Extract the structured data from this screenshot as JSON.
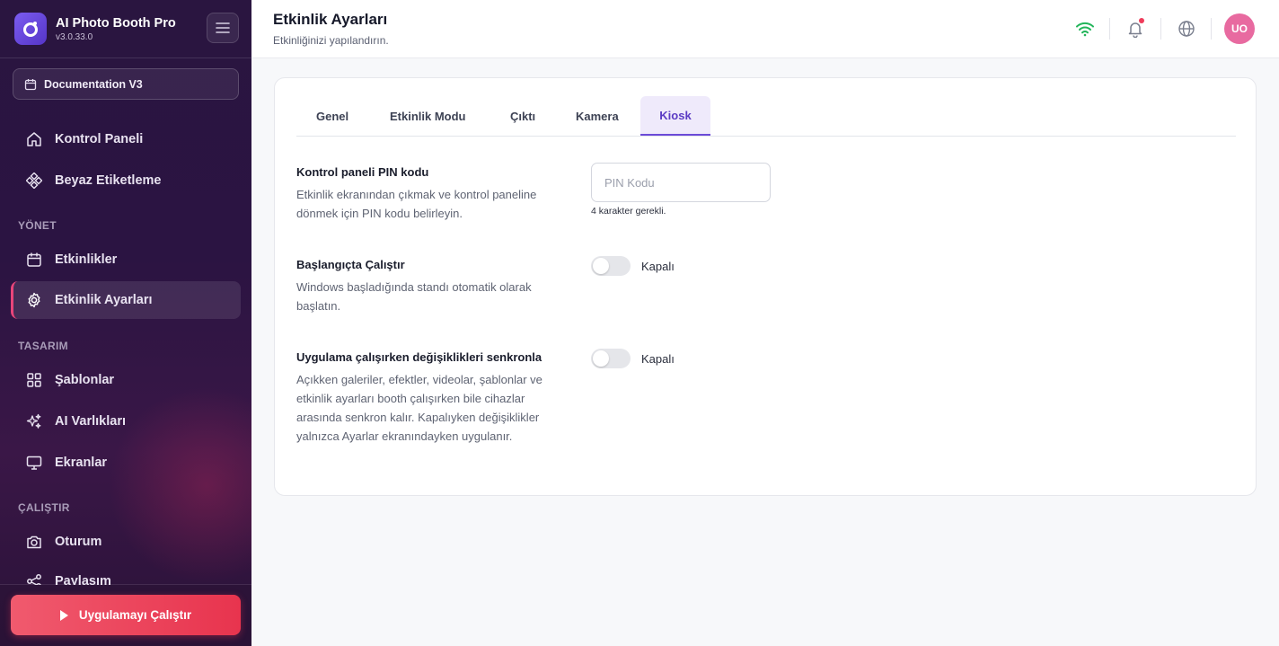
{
  "app": {
    "name": "AI Photo Booth Pro",
    "version": "v3.0.33.0"
  },
  "workspace": {
    "label": "Documentation V3"
  },
  "nav": {
    "top": [
      {
        "label": "Kontrol Paneli",
        "icon": "home-icon"
      },
      {
        "label": "Beyaz Etiketleme",
        "icon": "diamond-icon"
      }
    ],
    "sections": [
      {
        "title": "YÖNET",
        "items": [
          {
            "label": "Etkinlikler",
            "icon": "calendar-icon"
          },
          {
            "label": "Etkinlik Ayarları",
            "icon": "settings-icon",
            "active": true
          }
        ]
      },
      {
        "title": "TASARIM",
        "items": [
          {
            "label": "Şablonlar",
            "icon": "grid-icon"
          },
          {
            "label": "AI Varlıkları",
            "icon": "sparkles-icon"
          },
          {
            "label": "Ekranlar",
            "icon": "monitor-icon"
          }
        ]
      },
      {
        "title": "ÇALIŞTIR",
        "items": [
          {
            "label": "Oturum",
            "icon": "camera-icon"
          },
          {
            "label": "Paylaşım",
            "icon": "share-icon"
          }
        ]
      }
    ],
    "run_button": "Uygulamayı Çalıştır"
  },
  "header": {
    "title": "Etkinlik Ayarları",
    "subtitle": "Etkinliğinizi yapılandırın.",
    "avatar_initials": "UO",
    "wifi_color": "#22b55a",
    "notification_dot_color": "#ef3b5a"
  },
  "tabs": [
    {
      "label": "Genel"
    },
    {
      "label": "Etkinlik Modu"
    },
    {
      "label": "Çıktı"
    },
    {
      "label": "Kamera"
    },
    {
      "label": "Kiosk",
      "active": true
    }
  ],
  "settings": {
    "pin": {
      "title": "Kontrol paneli PIN kodu",
      "description": "Etkinlik ekranından çıkmak ve kontrol paneline dönmek için PIN kodu belirleyin.",
      "placeholder": "PIN Kodu",
      "value": "",
      "hint": "4 karakter gerekli."
    },
    "autostart": {
      "title": "Başlangıçta Çalıştır",
      "description": "Windows başladığında standı otomatik olarak başlatın.",
      "state_label": "Kapalı",
      "enabled": false
    },
    "sync": {
      "title": "Uygulama çalışırken değişiklikleri senkronla",
      "description": "Açıkken galeriler, efektler, videolar, şablonlar ve etkinlik ayarları booth çalışırken bile cihazlar arasında senkron kalır. Kapalıyken değişiklikler yalnızca Ayarlar ekranındayken uygulanır.",
      "state_label": "Kapalı",
      "enabled": false
    }
  },
  "colors": {
    "accent": "#6b4bd8",
    "run_button": "#e8344e",
    "active_border": "#e8457a"
  }
}
